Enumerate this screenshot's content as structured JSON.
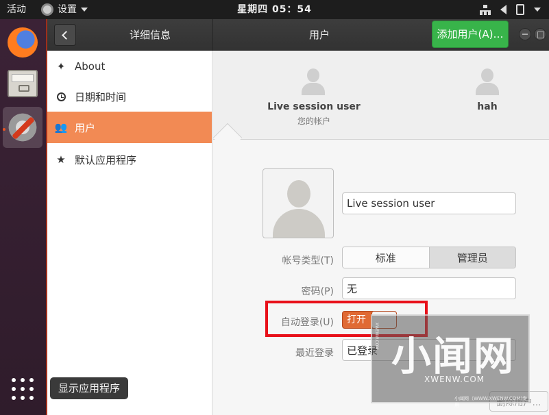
{
  "topbar": {
    "activities": "活动",
    "app_menu": "设置",
    "clock": "星期四 05：54"
  },
  "dock": {
    "items": [
      "firefox-icon",
      "files-icon",
      "settings-icon",
      "show-apps-icon"
    ],
    "tooltip": "显示应用程序"
  },
  "headerbar": {
    "sidebar_title": "详细信息",
    "main_title": "用户",
    "add_user": "添加用户(A)…"
  },
  "sidebar": {
    "items": [
      {
        "label": "About",
        "icon": "sparkle-icon"
      },
      {
        "label": "日期和时间",
        "icon": "clock-icon"
      },
      {
        "label": "用户",
        "icon": "users-icon",
        "selected": true
      },
      {
        "label": "默认应用程序",
        "icon": "star-icon"
      }
    ]
  },
  "users": {
    "list": [
      {
        "name": "Live session user",
        "subtitle": "您的帐户"
      },
      {
        "name": "hah"
      }
    ],
    "detail": {
      "name_value": "Live session user",
      "account_type_label": "帐号类型(T)",
      "account_type_options": [
        "标准",
        "管理员"
      ],
      "account_type_selected": "管理员",
      "password_label": "密码(P)",
      "password_value": "无",
      "autologin_label": "自动登录(U)",
      "autologin_state": "打开",
      "last_login_label": "最近登录",
      "last_login_value": "已登录",
      "remove_button": "删除用户…"
    }
  },
  "watermark": {
    "main": "小闻网",
    "url": "XWENW.COM",
    "side": "XWENW.COM",
    "footer": "小闻网（WWW.XWENW.COM)专用"
  },
  "colors": {
    "accent": "#f28a54",
    "add_button": "#38b44a",
    "toggle_on": "#e06a34",
    "highlight": "#e8101a"
  }
}
